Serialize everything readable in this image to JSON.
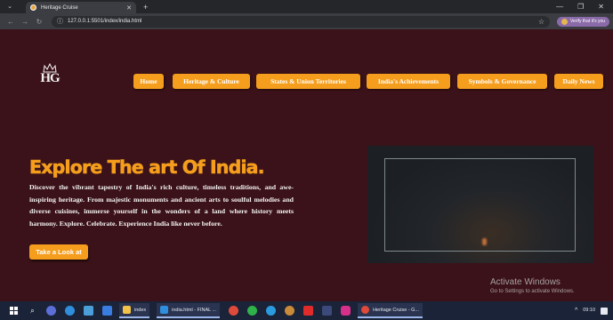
{
  "browser": {
    "tab_title": "Heritage Cruise",
    "url": "127.0.0.1:5501/index/india.html",
    "profile_label": "Verify that it's you"
  },
  "page": {
    "logo_text": "HG",
    "nav": [
      {
        "label": "Home"
      },
      {
        "label": "Heritage & Culture"
      },
      {
        "label": "States & Union Territories"
      },
      {
        "label": "India's Achievements"
      },
      {
        "label": "Symbols & Governance"
      },
      {
        "label": "Daily News"
      }
    ],
    "hero": {
      "title": "Explore The art Of India.",
      "description": "Discover the vibrant tapestry of India's rich culture, timeless traditions, and awe-inspiring heritage. From majestic monuments and ancient arts to soulful melodies and diverse cuisines, immerse yourself in the wonders of a land where history meets harmony. Explore. Celebrate. Experience India like never before.",
      "cta_label": "Take a Look at"
    },
    "watermark": {
      "title": "Activate Windows",
      "subtitle": "Go to Settings to activate Windows."
    },
    "accent_color": "#f59e1d",
    "background_color": "#3b1219"
  },
  "taskbar": {
    "apps": [
      {
        "label": "index",
        "icon": "folder-icon"
      },
      {
        "label": "india.html - FINAL ...",
        "icon": "vscode-icon"
      },
      {
        "label": "Heritage Cruise - G...",
        "icon": "chrome-icon"
      }
    ],
    "time": "09:10"
  }
}
